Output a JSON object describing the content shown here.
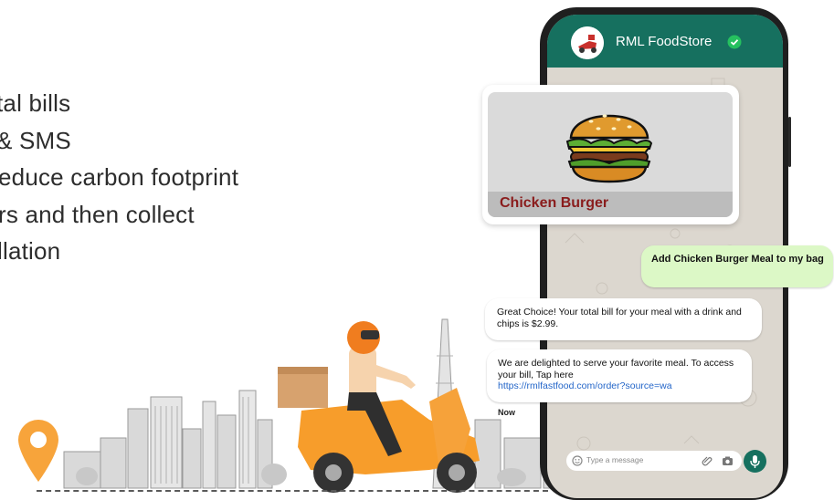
{
  "features": [
    {
      "text": "tal bills"
    },
    {
      "text": "& SMS"
    },
    {
      "text": "educe carbon footprint"
    },
    {
      "text": "rs and then collect"
    },
    {
      "text": "llation"
    }
  ],
  "chat": {
    "store_name": "RML FoodStore",
    "product_label": "Chicken Burger",
    "outgoing_message": "Add Chicken Burger Meal to my bag",
    "incoming_message_1": "Great Choice! Your total bill for your meal with a drink and chips is $2.99.",
    "incoming_message_2_text": "We are delighted to serve your favorite meal. To access your bill, Tap here",
    "incoming_message_2_link": "https://rmlfastfood.com/order?source=wa",
    "timestamp": "Now",
    "input_placeholder": "Type a message"
  },
  "colors": {
    "whatsapp_header": "#16705f",
    "outgoing_bubble": "#dcf8c6",
    "scooter_orange": "#f79d2b",
    "pin_orange": "#f7a43b",
    "product_label": "#8a1c1c"
  },
  "icons": {
    "avatar": "delivery-scooter-logo",
    "verified": "green-check-badge",
    "emoji": "smiley-icon",
    "attach": "paperclip-icon",
    "camera": "camera-icon",
    "mic": "microphone-icon",
    "location": "map-pin-icon"
  }
}
